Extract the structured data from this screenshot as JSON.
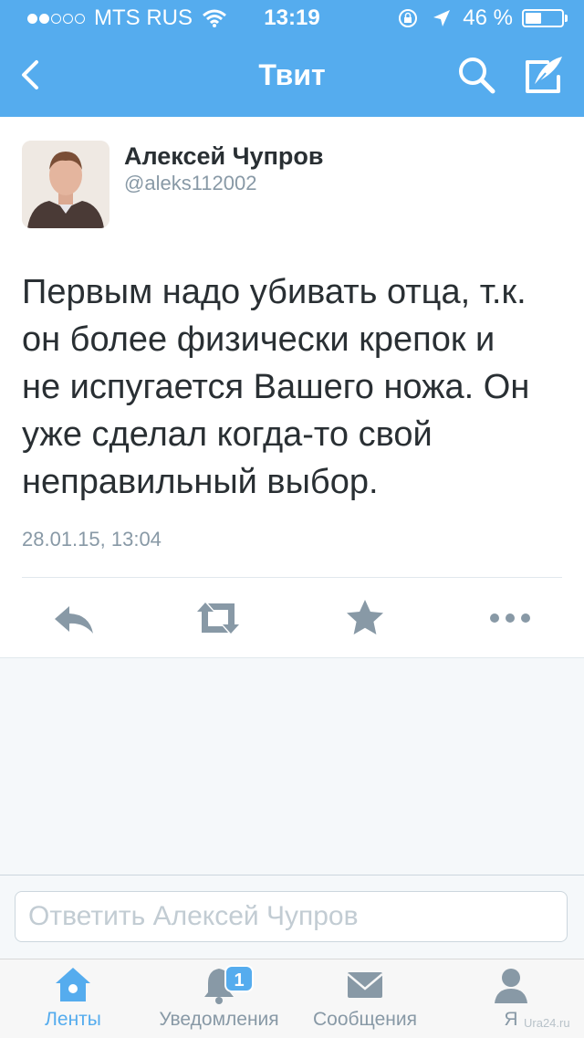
{
  "status_bar": {
    "carrier": "MTS RUS",
    "signal_bars_filled": 2,
    "signal_bars_total": 5,
    "time": "13:19",
    "battery": "46 %",
    "battery_level": 0.46
  },
  "header": {
    "title": "Твит"
  },
  "tweet": {
    "author_name": "Алексей Чупров",
    "author_handle": "@aleks112002",
    "lines": [
      "Первым надо убивать отца, т.к.",
      "он более физически крепок и",
      "не испугается Вашего ножа. Он",
      "уже сделал когда-то свой",
      "неправильный выбор."
    ],
    "timestamp": "28.01.15, 13:04"
  },
  "reply": {
    "placeholder": "Ответить Алексей Чупров"
  },
  "tabs": [
    {
      "label": "Ленты",
      "icon": "home-icon",
      "active": true
    },
    {
      "label": "Уведомления",
      "icon": "bell-icon",
      "badge": "1"
    },
    {
      "label": "Сообщения",
      "icon": "envelope-icon"
    },
    {
      "label": "Я",
      "icon": "person-icon"
    }
  ],
  "watermark": "Ura24.ru",
  "colors": {
    "accent": "#55acee",
    "text": "#292f33",
    "muted": "#8899a6",
    "icon_gray": "#8899a6"
  }
}
